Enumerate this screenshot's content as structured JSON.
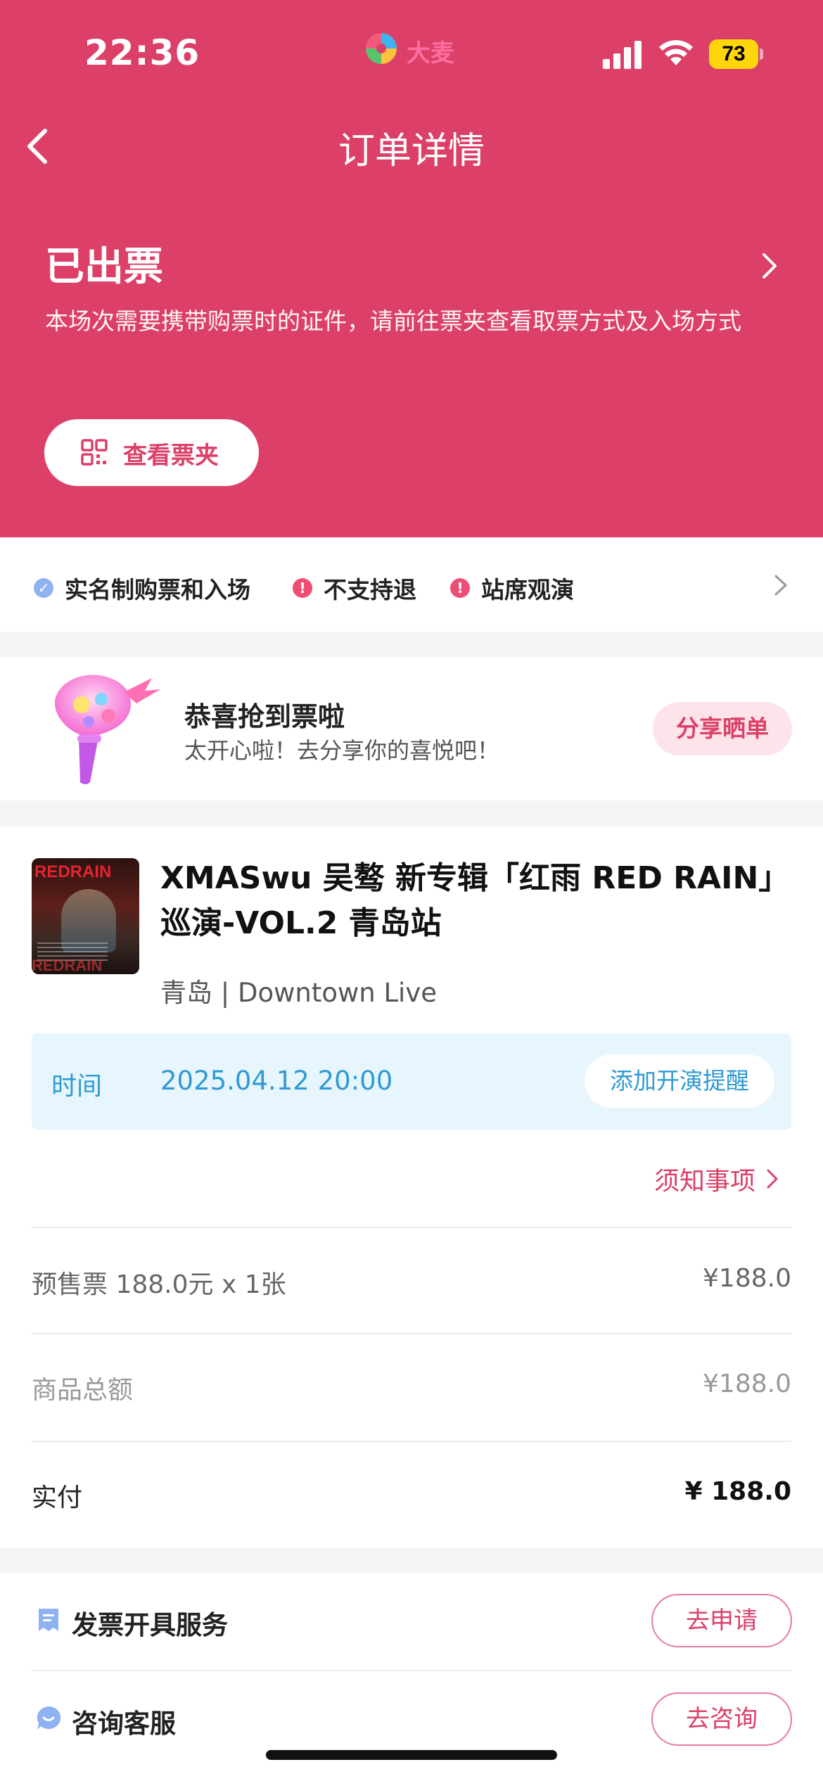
{
  "status_bar": {
    "time": "22:36",
    "battery": "73",
    "app_logo_text": "大麦"
  },
  "nav": {
    "title": "订单详情"
  },
  "order": {
    "status": "已出票",
    "description": "本场次需要携带购票时的证件，请前往票夹查看取票方式及入场方式",
    "ticket_button": "查看票夹"
  },
  "tags": [
    {
      "label": "实名制购票和入场",
      "icon": "check-circle-icon",
      "color": "#8fb3f2"
    },
    {
      "label": "不支持退",
      "icon": "exclamation-circle-icon",
      "color": "#ee4d74"
    },
    {
      "label": "站席观演",
      "icon": "exclamation-circle-icon",
      "color": "#ee4d74"
    }
  ],
  "congrats": {
    "title": "恭喜抢到票啦",
    "subtitle": "太开心啦！去分享你的喜悦吧！",
    "share_button": "分享晒单"
  },
  "event": {
    "poster_text_top": "REDRAIN",
    "poster_text_bottom": "REDRAIN",
    "title": "XMASwu 吴骜 新专辑「红雨 RED RAIN」巡演-VOL.2 青岛站",
    "venue": "青岛 | Downtown Live",
    "time_label": "时间",
    "time_value": "2025.04.12 20:00",
    "remind_button": "添加开演提醒",
    "notice_link": "须知事项"
  },
  "price_rows": [
    {
      "label": "预售票 188.0元 x 1张",
      "value": "¥188.0"
    },
    {
      "label": "商品总额",
      "value": "¥188.0"
    },
    {
      "label": "实付",
      "value": "¥ 188.0"
    }
  ],
  "services": [
    {
      "label": "发票开具服务",
      "button": "去申请",
      "icon": "invoice-icon"
    },
    {
      "label": "咨询客服",
      "button": "去咨询",
      "icon": "customer-service-icon"
    }
  ],
  "colors": {
    "brand": "#dc4068",
    "info": "#2f9ad3"
  }
}
